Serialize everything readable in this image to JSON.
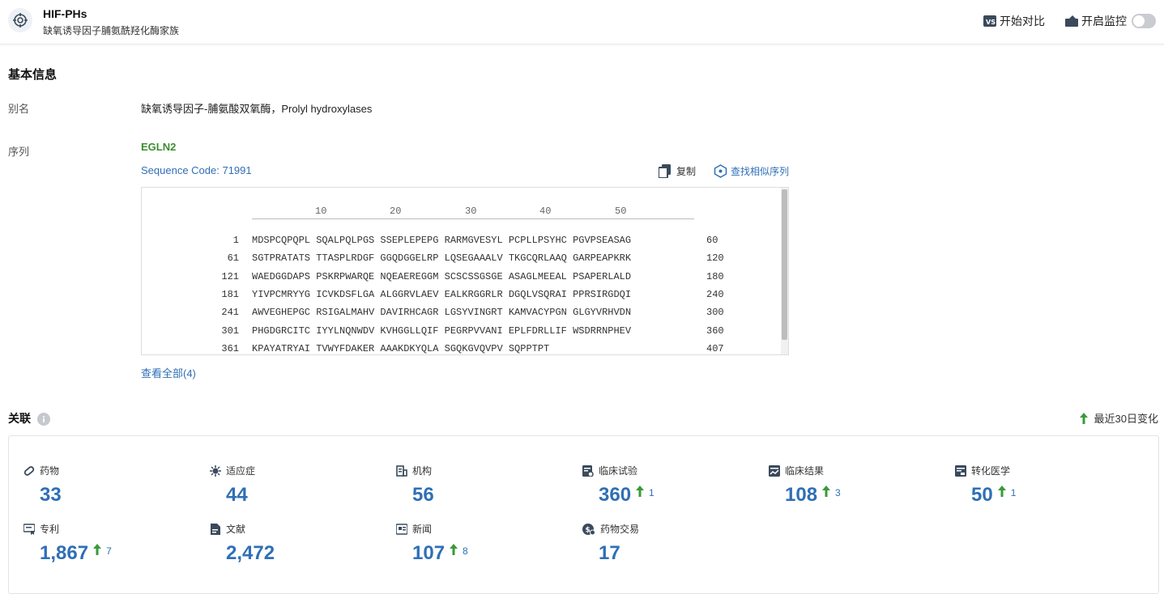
{
  "header": {
    "title": "HIF-PHs",
    "subtitle": "缺氧诱导因子脯氨酰羟化酶家族",
    "compare_label": "开始对比",
    "monitor_label": "开启监控"
  },
  "basic": {
    "section_title": "基本信息",
    "alias_label": "别名",
    "alias_value": "缺氧诱导因子-脯氨酸双氧酶，Prolyl hydroxylases",
    "sequence_label": "序列",
    "gene": "EGLN2",
    "sequence_code": "Sequence Code: 71991",
    "copy_label": "复制",
    "similar_label": "查找相似序列",
    "view_all": "查看全部(4)",
    "ruler": [
      "10",
      "20",
      "30",
      "40",
      "50"
    ],
    "rows": [
      {
        "start": "1",
        "seq": "MDSPCQPQPL SQALPQLPGS SSEPLEPEPG RARMGVESYL PCPLLPSYHC PGVPSEASAG",
        "end": "60"
      },
      {
        "start": "61",
        "seq": "SGTPRATATS TTASPLRDGF GGQDGGELRP LQSEGAAALV TKGCQRLAAQ GARPEAPKRK",
        "end": "120"
      },
      {
        "start": "121",
        "seq": "WAEDGGDAPS PSKRPWARQE NQEAEREGGM SCSCSSGSGE ASAGLMEEAL PSAPERLALD",
        "end": "180"
      },
      {
        "start": "181",
        "seq": "YIVPCMRYYG ICVKDSFLGA ALGGRVLAEV EALKRGGRLR DGQLVSQRAI PPRSIRGDQI",
        "end": "240"
      },
      {
        "start": "241",
        "seq": "AWVEGHEPGC RSIGALMAHV DAVIRHCAGR LGSYVINGRT KAMVACYPGN GLGYVRHVDN",
        "end": "300"
      },
      {
        "start": "301",
        "seq": "PHGDGRCITC IYYLNQNWDV KVHGGLLQIF PEGRPVVANI EPLFDRLLIF WSDRRNPHEV",
        "end": "360"
      },
      {
        "start": "361",
        "seq": "KPAYATRYAI TVWYFDAKER AAAKDKYQLA SGQKGVQVPV SQPPTPT",
        "end": "407"
      }
    ]
  },
  "related": {
    "section_title": "关联",
    "change_label": "最近30日变化",
    "stats": [
      {
        "label": "药物",
        "value": "33",
        "change": ""
      },
      {
        "label": "适应症",
        "value": "44",
        "change": ""
      },
      {
        "label": "机构",
        "value": "56",
        "change": ""
      },
      {
        "label": "临床试验",
        "value": "360",
        "change": "1"
      },
      {
        "label": "临床结果",
        "value": "108",
        "change": "3"
      },
      {
        "label": "转化医学",
        "value": "50",
        "change": "1"
      },
      {
        "label": "专利",
        "value": "1,867",
        "change": "7"
      },
      {
        "label": "文献",
        "value": "2,472",
        "change": ""
      },
      {
        "label": "新闻",
        "value": "107",
        "change": "8"
      },
      {
        "label": "药物交易",
        "value": "17",
        "change": ""
      }
    ],
    "icons": [
      "pill-icon",
      "virus-icon",
      "building-icon",
      "clinical-trial-icon",
      "clinical-result-icon",
      "translational-icon",
      "patent-icon",
      "document-icon",
      "news-icon",
      "deal-icon"
    ]
  },
  "colors": {
    "accent": "#2f6fb5",
    "green": "#3c8d2f",
    "arrow": "#3a9a3a"
  }
}
